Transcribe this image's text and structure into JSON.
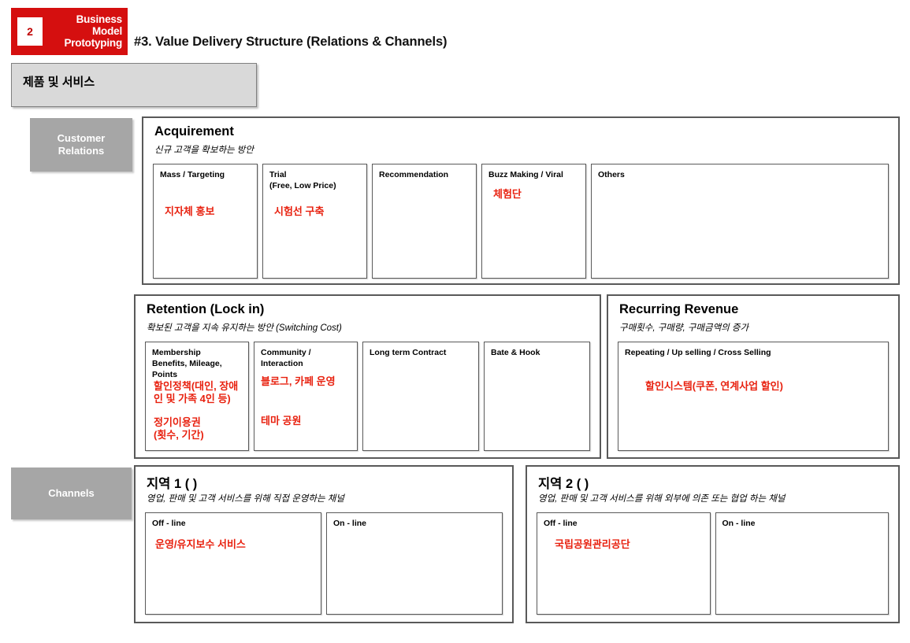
{
  "header": {
    "logo_number": "2",
    "logo_line1": "Business",
    "logo_line2": "Model",
    "logo_line3": "Prototyping",
    "logo_color": "#d50f0f",
    "title": "#3. Value Delivery Structure (Relations & Channels)"
  },
  "product_service": {
    "label": "제품 및 서비스"
  },
  "sidebar": {
    "customer_relations": "Customer\nRelations",
    "customer_relations_line1": "Customer",
    "customer_relations_line2": "Relations",
    "channels": "Channels",
    "color": "#a6a6a6"
  },
  "note_color": "#e8210f",
  "acquirement": {
    "title": "Acquirement",
    "subtitle": "신규 고객을 확보하는 방안",
    "cards": [
      {
        "title": "Mass / Targeting",
        "note": "지자체 홍보"
      },
      {
        "title": "Trial\n(Free, Low Price)",
        "title_line1": "Trial",
        "title_line2": "(Free, Low Price)",
        "note": "시험선 구축"
      },
      {
        "title": "Recommendation",
        "note": ""
      },
      {
        "title": "Buzz Making / Viral",
        "note": "체험단"
      },
      {
        "title": "Others",
        "note": ""
      }
    ]
  },
  "retention": {
    "title": "Retention (Lock in)",
    "subtitle": "확보된 고객을 지속 유지하는 방안 (Switching Cost)",
    "cards": [
      {
        "title_line1": "Membership",
        "title_line2": "Benefits, Mileage,",
        "title_line3": "Points",
        "note1": "할인정책(대인, 장애인 및 가족 4인 등)",
        "note2": "정기이용권\n(횟수, 기간)",
        "note2_line1": "정기이용권",
        "note2_line2": "(횟수, 기간)"
      },
      {
        "title_line1": "Community /",
        "title_line2": "Interaction",
        "note1": "블로그, 카페 운영",
        "note2": "테마 공원"
      },
      {
        "title": "Long term Contract",
        "note": ""
      },
      {
        "title": "Bate & Hook",
        "note": ""
      }
    ]
  },
  "recurring": {
    "title": "Recurring Revenue",
    "subtitle": "구매횟수, 구매량, 구매금액의 증가",
    "cards": [
      {
        "title": "Repeating / Up selling / Cross Selling",
        "note": "할인시스템(쿠폰, 연계사업 할인)"
      }
    ]
  },
  "region1": {
    "title": "지역 1 (                    )",
    "subtitle": "영업, 판매 및 고객 서비스를 위해 직접 운영하는 채널",
    "cards": [
      {
        "title": "Off - line",
        "note": "운영/유지보수 서비스"
      },
      {
        "title": "On - line",
        "note": ""
      }
    ]
  },
  "region2": {
    "title": "지역 2 (                    )",
    "subtitle": "영업, 판매 및 고객 서비스를 위해 외부에 의존 또는 협업 하는 채널",
    "cards": [
      {
        "title": "Off - line",
        "note": "국립공원관리공단"
      },
      {
        "title": "On - line",
        "note": ""
      }
    ]
  }
}
